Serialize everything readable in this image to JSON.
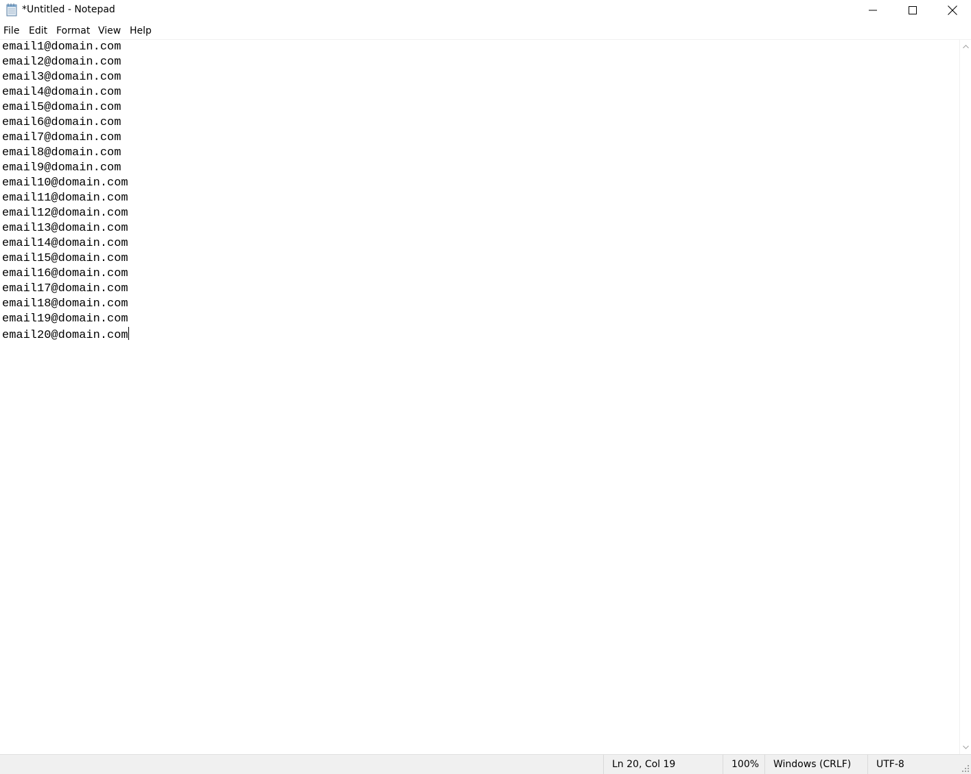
{
  "window": {
    "title": "*Untitled - Notepad",
    "icon": "notepad-icon"
  },
  "caption_buttons": {
    "minimize": "minimize-icon",
    "maximize": "maximize-icon",
    "close": "close-icon"
  },
  "menu": {
    "items": [
      {
        "label": "File"
      },
      {
        "label": "Edit"
      },
      {
        "label": "Format"
      },
      {
        "label": "View"
      },
      {
        "label": "Help"
      }
    ]
  },
  "editor": {
    "lines": [
      "email1@domain.com",
      "email2@domain.com",
      "email3@domain.com",
      "email4@domain.com",
      "email5@domain.com",
      "email6@domain.com",
      "email7@domain.com",
      "email8@domain.com",
      "email9@domain.com",
      "email10@domain.com",
      "email11@domain.com",
      "email12@domain.com",
      "email13@domain.com",
      "email14@domain.com",
      "email15@domain.com",
      "email16@domain.com",
      "email17@domain.com",
      "email18@domain.com",
      "email19@domain.com",
      "email20@domain.com"
    ]
  },
  "statusbar": {
    "position": "Ln 20, Col 19",
    "zoom": "100%",
    "line_ending": "Windows (CRLF)",
    "encoding": "UTF-8"
  }
}
